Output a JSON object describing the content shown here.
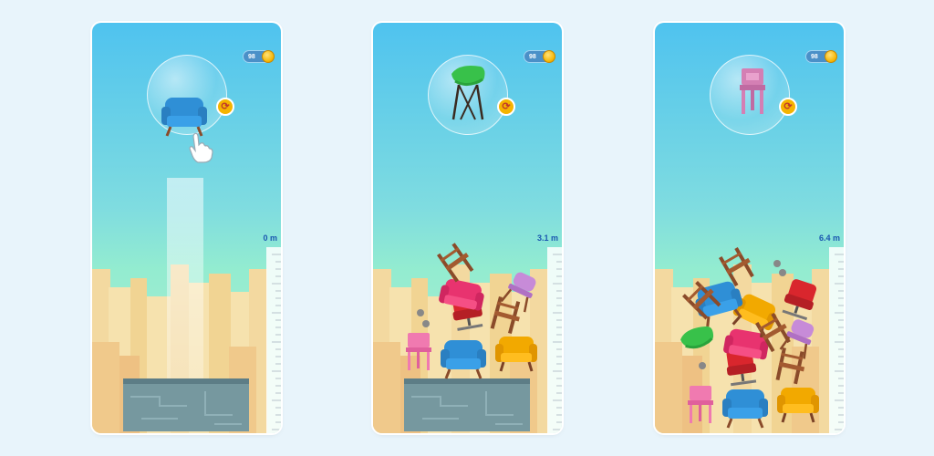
{
  "screens": [
    {
      "coins": "98",
      "height": "0 m"
    },
    {
      "coins": "98",
      "height": "3.1 m"
    },
    {
      "coins": "98",
      "height": "6.4 m"
    }
  ],
  "icons": {
    "coin": "coin-icon",
    "rotate": "rotate-icon",
    "hand": "tap-hand-icon"
  },
  "colors": {
    "sky_top": "#4fc3ef",
    "sky_bottom": "#b9efcf",
    "height_label": "#1a56b0",
    "coin": "#f5b400"
  }
}
